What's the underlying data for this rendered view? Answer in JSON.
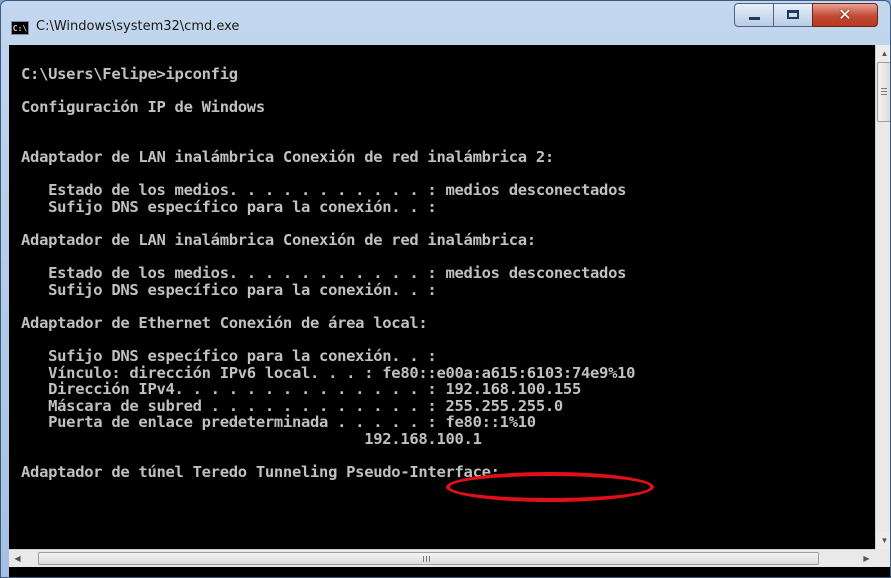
{
  "window": {
    "title": "C:\\Windows\\system32\\cmd.exe",
    "icon_label": "C:\\",
    "controls": {
      "minimize": "minimize-icon",
      "maximize": "maximize-icon",
      "close": "✕"
    }
  },
  "console": {
    "lines": [
      "C:\\Users\\Felipe>ipconfig",
      "",
      "Configuración IP de Windows",
      "",
      "",
      "Adaptador de LAN inalámbrica Conexión de red inalámbrica 2:",
      "",
      "   Estado de los medios. . . . . . . . . . . : medios desconectados",
      "   Sufijo DNS específico para la conexión. . :",
      "",
      "Adaptador de LAN inalámbrica Conexión de red inalámbrica:",
      "",
      "   Estado de los medios. . . . . . . . . . . : medios desconectados",
      "   Sufijo DNS específico para la conexión. . :",
      "",
      "Adaptador de Ethernet Conexión de área local:",
      "",
      "   Sufijo DNS específico para la conexión. . :",
      "   Vínculo: dirección IPv6 local. . . : fe80::e00a:a615:6103:74e9%10",
      "   Dirección IPv4. . . . . . . . . . . . . . : 192.168.100.155",
      "   Máscara de subred . . . . . . . . . . . . : 255.255.255.0",
      "   Puerta de enlace predeterminada . . . . . : fe80::1%10",
      "                                      192.168.100.1",
      "",
      "Adaptador de túnel Teredo Tunneling Pseudo-Interface:"
    ]
  },
  "annotation": {
    "color": "#e0101a"
  },
  "scrollbars": {
    "horizontal_thumb_grip": "|||"
  }
}
